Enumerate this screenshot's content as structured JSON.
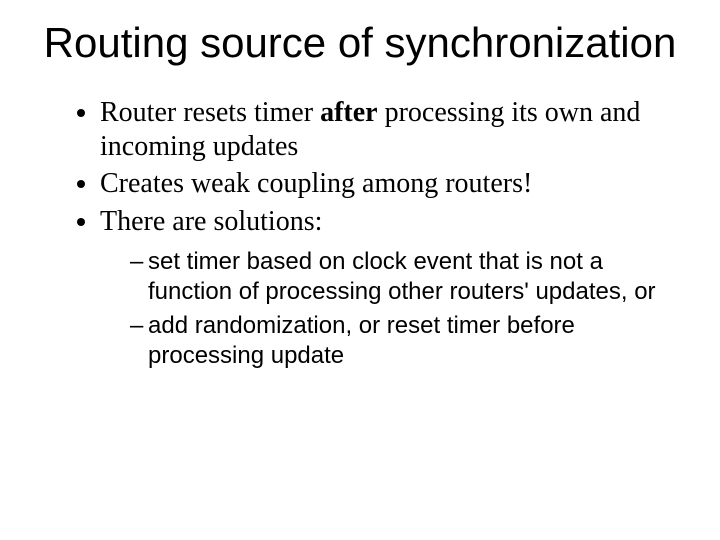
{
  "title": "Routing source of synchronization",
  "bullets": [
    {
      "pre": "Router resets timer ",
      "bold": "after",
      "post": " processing its own and incoming updates"
    },
    {
      "pre": "Creates weak coupling among routers!",
      "bold": "",
      "post": ""
    },
    {
      "pre": "There are solutions:",
      "bold": "",
      "post": ""
    }
  ],
  "sub_bullets": [
    "set timer based on clock event that is not a function of processing other routers' updates, or",
    "add randomization, or reset timer before processing update"
  ]
}
